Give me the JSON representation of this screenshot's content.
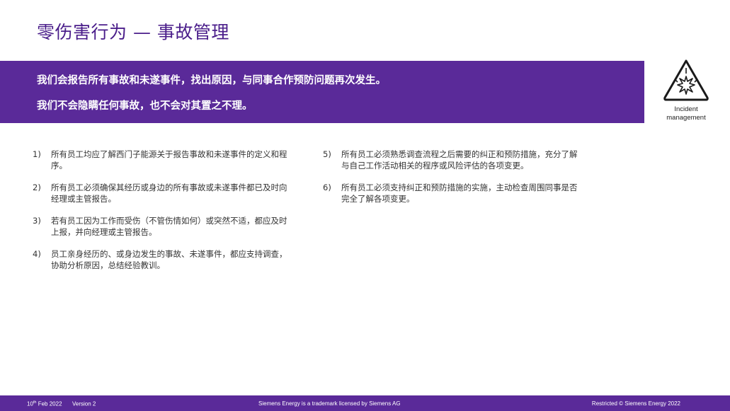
{
  "slide": {
    "title": "零伤害行为 — 事故管理",
    "banner": {
      "line1": "我们会报告所有事故和未遂事件，找出原因，与同事合作预防问题再次发生。",
      "line2": "我们不会隐瞒任何事故，也不会对其置之不理。"
    },
    "incident_icon": {
      "label_line1": "Incident",
      "label_line2": "management"
    },
    "left_items": [
      {
        "num": "1)",
        "text": "所有员工均应了解西门子能源关于报告事故和未遂事件的定义和程序。"
      },
      {
        "num": "2)",
        "text": "所有员工必须确保其经历或身边的所有事故或未遂事件都已及时向经理或主管报告。"
      },
      {
        "num": "3)",
        "text": "若有员工因为工作而受伤（不管伤情如何）或突然不适，都应及时上报，并向经理或主管报告。"
      },
      {
        "num": "4)",
        "text": "员工亲身经历的、或身边发生的事故、未遂事件，都应支持调查，协助分析原因，总结经验教训。"
      }
    ],
    "right_items": [
      {
        "num": "5)",
        "text": "所有员工必须熟悉调查流程之后需要的纠正和预防措施，充分了解与自己工作活动相关的程序或风险评估的各项变更。"
      },
      {
        "num": "6)",
        "text": "所有员工必须支持纠正和预防措施的实施，主动检查周围同事是否完全了解各项变更。"
      }
    ],
    "footer": {
      "date_day": "10",
      "date_suffix": "th",
      "date_rest": " Feb 2022",
      "version": "Version 2",
      "trademark": "Siemens Energy is a trademark licensed by Siemens AG",
      "restricted": "Restricted © Siemens Energy 2022"
    }
  },
  "colors": {
    "brand_purple": "#5a2a99",
    "title_purple": "#4a1d8a"
  }
}
